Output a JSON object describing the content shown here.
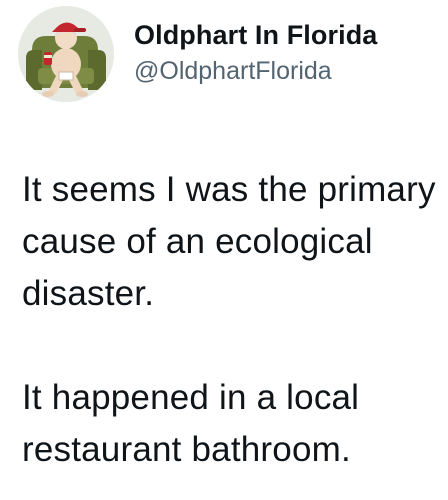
{
  "author": {
    "display_name": "Oldphart In Florida",
    "handle": "@OldphartFlorida",
    "avatar_icon": "cartoon-old-man-in-armchair-avatar"
  },
  "tweet": {
    "paragraphs": [
      "It seems I was the primary cause of an ecological disaster.",
      "It happened in a local restaurant bathroom."
    ]
  },
  "colors": {
    "text_primary": "#0f1419",
    "text_secondary": "#536471",
    "background": "#ffffff"
  }
}
